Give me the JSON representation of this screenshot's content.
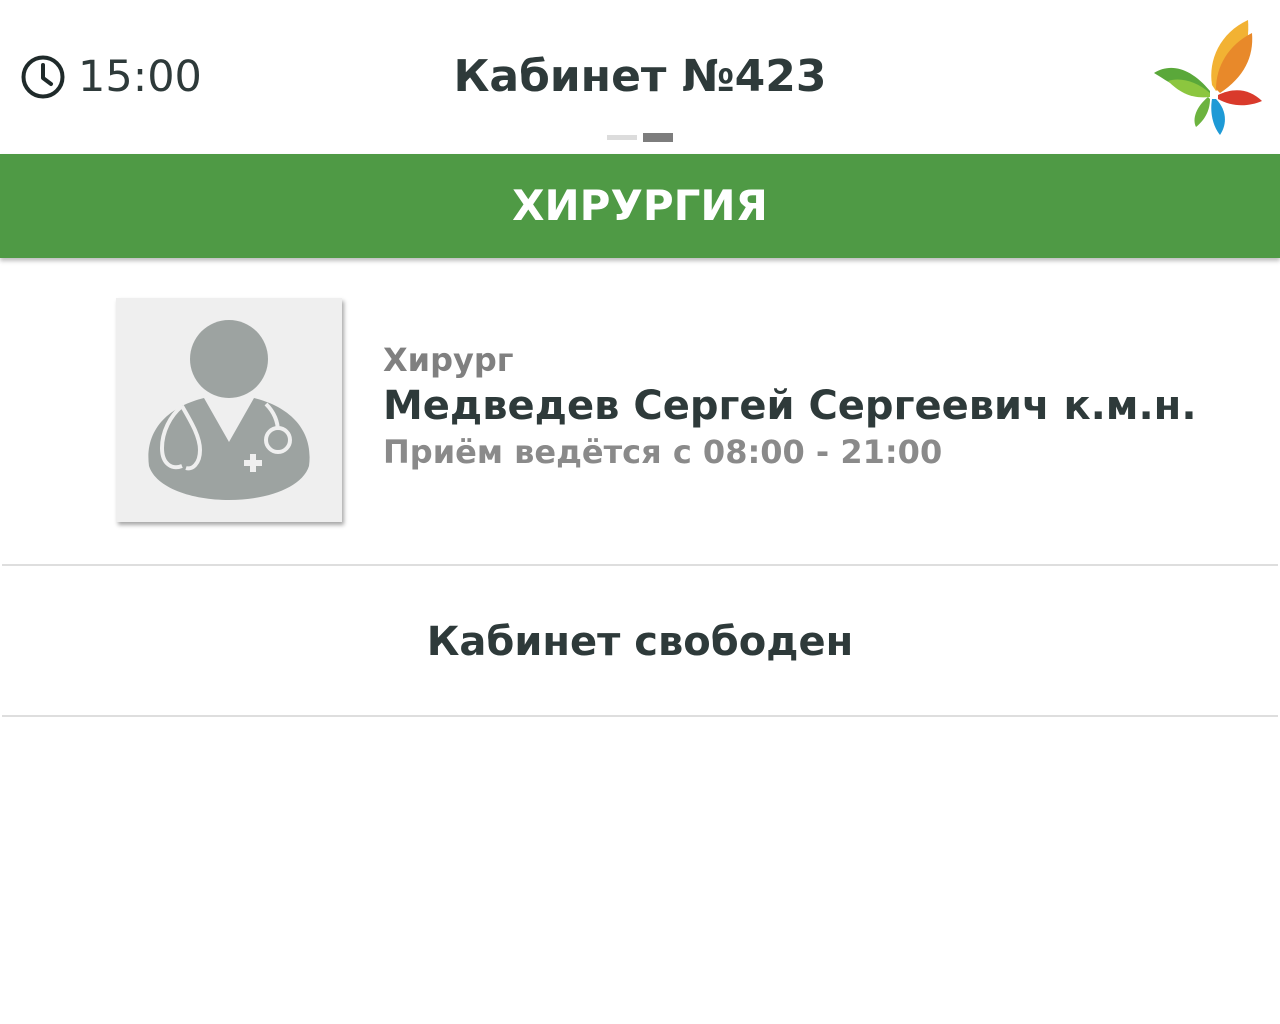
{
  "header": {
    "time": "15:00",
    "clock_icon": "clock-icon",
    "title": "Кабинет №423",
    "logo_icon": "butterfly-logo"
  },
  "pager": {
    "pages": 2,
    "active_page": 2
  },
  "department": {
    "name": "ХИРУРГИЯ",
    "color": "#4f9a45"
  },
  "doctor": {
    "avatar_icon": "doctor-avatar-icon",
    "role": "Хирург",
    "name": "Медведев Сергей Сергеевич  к.м.н.",
    "hours": "Приём ведётся с 08:00 - 21:00"
  },
  "status": {
    "text": "Кабинет свободен"
  }
}
